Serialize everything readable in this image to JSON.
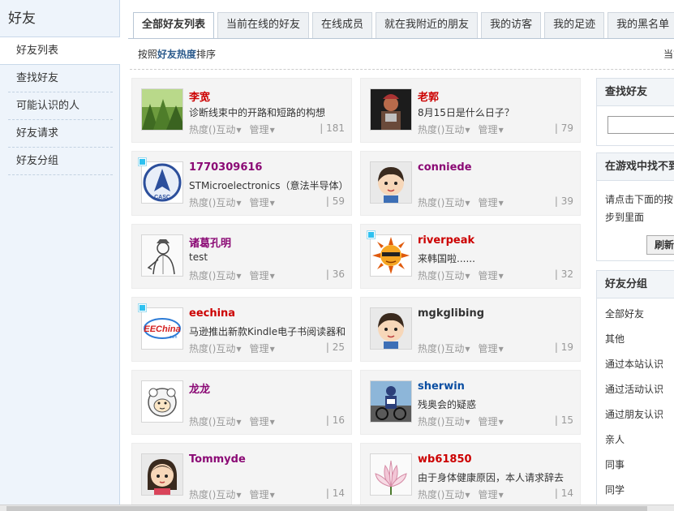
{
  "sidebar": {
    "title": "好友",
    "items": [
      {
        "label": "好友列表"
      },
      {
        "label": "查找好友"
      },
      {
        "label": "可能认识的人"
      },
      {
        "label": "好友请求"
      },
      {
        "label": "好友分组"
      }
    ]
  },
  "tabs": [
    {
      "label": "全部好友列表"
    },
    {
      "label": "当前在线的好友"
    },
    {
      "label": "在线成员"
    },
    {
      "label": "就在我附近的朋友"
    },
    {
      "label": "我的访客"
    },
    {
      "label": "我的足迹"
    },
    {
      "label": "我的黑名单"
    }
  ],
  "sort": {
    "prefix": "按照",
    "key": "好友热度",
    "suffix": "排序",
    "right": "当前"
  },
  "meta_labels": {
    "hot": "热度()",
    "interact": "互动",
    "manage": "管理",
    "arrow": "▼",
    "sep": "|"
  },
  "colors": {
    "name_red": "#cc0000",
    "name_purple": "#8b0a75",
    "name_blue": "#0b4ea2",
    "name_dark": "#333333"
  },
  "friends": [
    {
      "name": "李宽",
      "desc": "诊断线束中的开路和短路的构想",
      "count": "181",
      "online": false,
      "avatar": "forest"
    },
    {
      "name": "老郭",
      "desc": "8月15日是什么日子？",
      "count": "79",
      "online": false,
      "avatar": "warrior"
    },
    {
      "name": "1770309616",
      "desc": "STMicroelectronics（意法半导体）",
      "count": "59",
      "online": true,
      "avatar": "casc-logo"
    },
    {
      "name": "conniede",
      "desc": "",
      "count": "39",
      "online": false,
      "avatar": "default-boy"
    },
    {
      "name": "诸葛孔明",
      "desc": "test",
      "count": "36",
      "online": false,
      "avatar": "sage-sketch"
    },
    {
      "name": "riverpeak",
      "desc": "来韩国啦......",
      "count": "32",
      "online": true,
      "avatar": "sun-sunglasses"
    },
    {
      "name": "eechina",
      "desc": "马逊推出新款Kindle电子书阅读器和",
      "count": "25",
      "online": true,
      "avatar": "eechina-logo"
    },
    {
      "name": "mgkglibing",
      "desc": "",
      "count": "19",
      "online": false,
      "avatar": "default-boy"
    },
    {
      "name": "龙龙",
      "desc": "",
      "count": "16",
      "online": false,
      "avatar": "sheep"
    },
    {
      "name": "sherwin",
      "desc": "残奥会的疑惑",
      "count": "15",
      "online": false,
      "avatar": "cyclist"
    },
    {
      "name": "Tommyde",
      "desc": "",
      "count": "14",
      "online": false,
      "avatar": "default-girl"
    },
    {
      "name": "wb61850",
      "desc": "由于身体健康原因，本人请求辞去",
      "count": "14",
      "online": false,
      "avatar": "lotus"
    }
  ],
  "find_panel": {
    "title": "查找好友"
  },
  "game_panel": {
    "title": "在游戏中找不到",
    "line1": "请点击下面的按",
    "line2": "步到里面",
    "button": "刷新"
  },
  "group_panel": {
    "title": "好友分组",
    "groups": [
      {
        "label": "全部好友"
      },
      {
        "label": "其他"
      },
      {
        "label": "通过本站认识"
      },
      {
        "label": "通过活动认识"
      },
      {
        "label": "通过朋友认识"
      },
      {
        "label": "亲人"
      },
      {
        "label": "同事"
      },
      {
        "label": "同学"
      }
    ]
  }
}
